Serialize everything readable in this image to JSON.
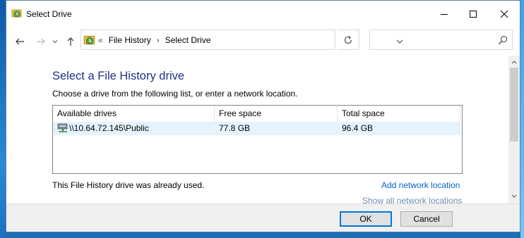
{
  "window": {
    "title": "Select Drive",
    "controls": {
      "minimize": "minimize-icon",
      "maximize": "maximize-icon",
      "close": "close-icon"
    }
  },
  "nav": {
    "back": "back-arrow-icon",
    "forward": "forward-arrow-icon",
    "recent": "chevron-down-icon",
    "up": "up-arrow-icon"
  },
  "address": {
    "overflow": "«",
    "breadcrumbs": [
      "File History",
      "Select Drive"
    ],
    "separator": "›"
  },
  "search": {
    "value": "",
    "placeholder": ""
  },
  "main": {
    "heading": "Select a File History drive",
    "subtitle": "Choose a drive from the following list, or enter a network location.",
    "table": {
      "columns": [
        "Available drives",
        "Free space",
        "Total space"
      ],
      "rows": [
        {
          "name": "\\\\10.64.72.145\\Public",
          "free": "77.8 GB",
          "total": "96.4 GB",
          "icon": "network-drive-icon"
        }
      ]
    },
    "status": "This File History drive was already used.",
    "add_network_location": "Add network location",
    "show_all_network_locations": "Show all network locations"
  },
  "footer": {
    "ok": "OK",
    "cancel": "Cancel"
  },
  "colors": {
    "heading": "#1e3287",
    "link": "#0066cc",
    "selected_row": "#e5f3ff",
    "ok_border": "#0078d7"
  }
}
